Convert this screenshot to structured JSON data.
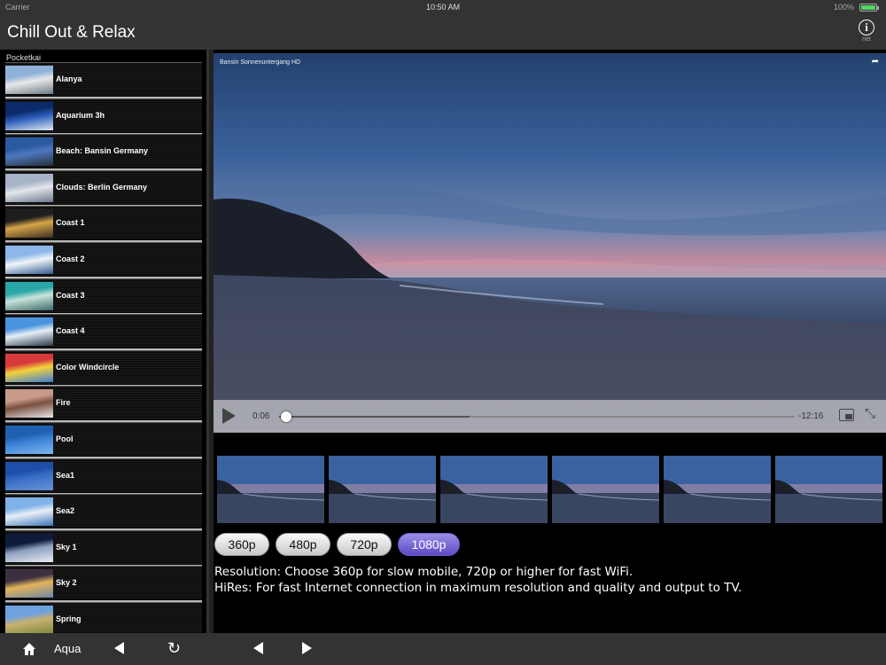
{
  "status_bar": {
    "carrier": "Carrier",
    "time": "10:50 AM",
    "battery": "100%"
  },
  "nav": {
    "title": "Chill Out & Relax",
    "info_icon": "i",
    "info_label": "net"
  },
  "sidebar": {
    "section": "Pocketkai",
    "items": [
      {
        "label": "Alanya",
        "thumb_colors": [
          "#8fb2d8",
          "#e8e8e8",
          "#6d7b86"
        ]
      },
      {
        "label": "Aquarium 3h",
        "thumb_colors": [
          "#0a2a6a",
          "#2b5db8",
          "#dfe9f7"
        ]
      },
      {
        "label": "Beach: Bansin Germany",
        "thumb_colors": [
          "#2c5aa0",
          "#4c78be",
          "#2a2f3a"
        ]
      },
      {
        "label": "Clouds: Berlin Germany",
        "thumb_colors": [
          "#a7b3c6",
          "#e3e6ea",
          "#6b7a8f"
        ]
      },
      {
        "label": "Coast 1",
        "thumb_colors": [
          "#1e1e1e",
          "#d8a54a",
          "#3b3020"
        ]
      },
      {
        "label": "Coast 2",
        "thumb_colors": [
          "#8db7e8",
          "#f0f4f8",
          "#2f5c8f"
        ]
      },
      {
        "label": "Coast 3",
        "thumb_colors": [
          "#29a7a8",
          "#c9e3dc",
          "#3b6b6a"
        ]
      },
      {
        "label": "Coast 4",
        "thumb_colors": [
          "#4a93dd",
          "#e6eef6",
          "#2a3b4a"
        ]
      },
      {
        "label": "Color Windcircle",
        "thumb_colors": [
          "#d63a3a",
          "#f3d33b",
          "#3a7bd6"
        ]
      },
      {
        "label": "Fire",
        "thumb_colors": [
          "#c89a8a",
          "#7a5040",
          "#e8e8e8"
        ]
      },
      {
        "label": "Pool",
        "thumb_colors": [
          "#1e5fb0",
          "#3b82d6",
          "#7fb5ef"
        ]
      },
      {
        "label": "Sea1",
        "thumb_colors": [
          "#1e4fa8",
          "#3a6fc8",
          "#6892d6"
        ]
      },
      {
        "label": "Sea2",
        "thumb_colors": [
          "#7fb2e8",
          "#e8eff7",
          "#3e78b8"
        ]
      },
      {
        "label": "Sky 1",
        "thumb_colors": [
          "#0d1a3a",
          "#8fa0c0",
          "#e8ebf2"
        ]
      },
      {
        "label": "Sky 2",
        "thumb_colors": [
          "#3a3040",
          "#e3b45a",
          "#6f85a8"
        ]
      },
      {
        "label": "Spring",
        "thumb_colors": [
          "#6fa0e0",
          "#c8b070",
          "#7a8a3a"
        ]
      }
    ]
  },
  "player": {
    "video_title": "Bansin Sonnenuntergang HD",
    "current_time": "0:06",
    "remaining_time": "-12:16",
    "progress": 0.013,
    "buffered": 0.37
  },
  "thumbnails_count": 6,
  "resolutions": [
    {
      "label": "360p",
      "active": false
    },
    {
      "label": "480p",
      "active": false
    },
    {
      "label": "720p",
      "active": false
    },
    {
      "label": "1080p",
      "active": true
    }
  ],
  "description": {
    "line1": "Resolution: Choose 360p for slow mobile, 720p or higher for fast WiFi.",
    "line2": "HiRes: For fast Internet connection in maximum resolution and quality and output to TV."
  },
  "toolbar": {
    "label": "Aqua"
  },
  "colors": {
    "active_button": "#6c5bd0",
    "bar": "#333333"
  }
}
